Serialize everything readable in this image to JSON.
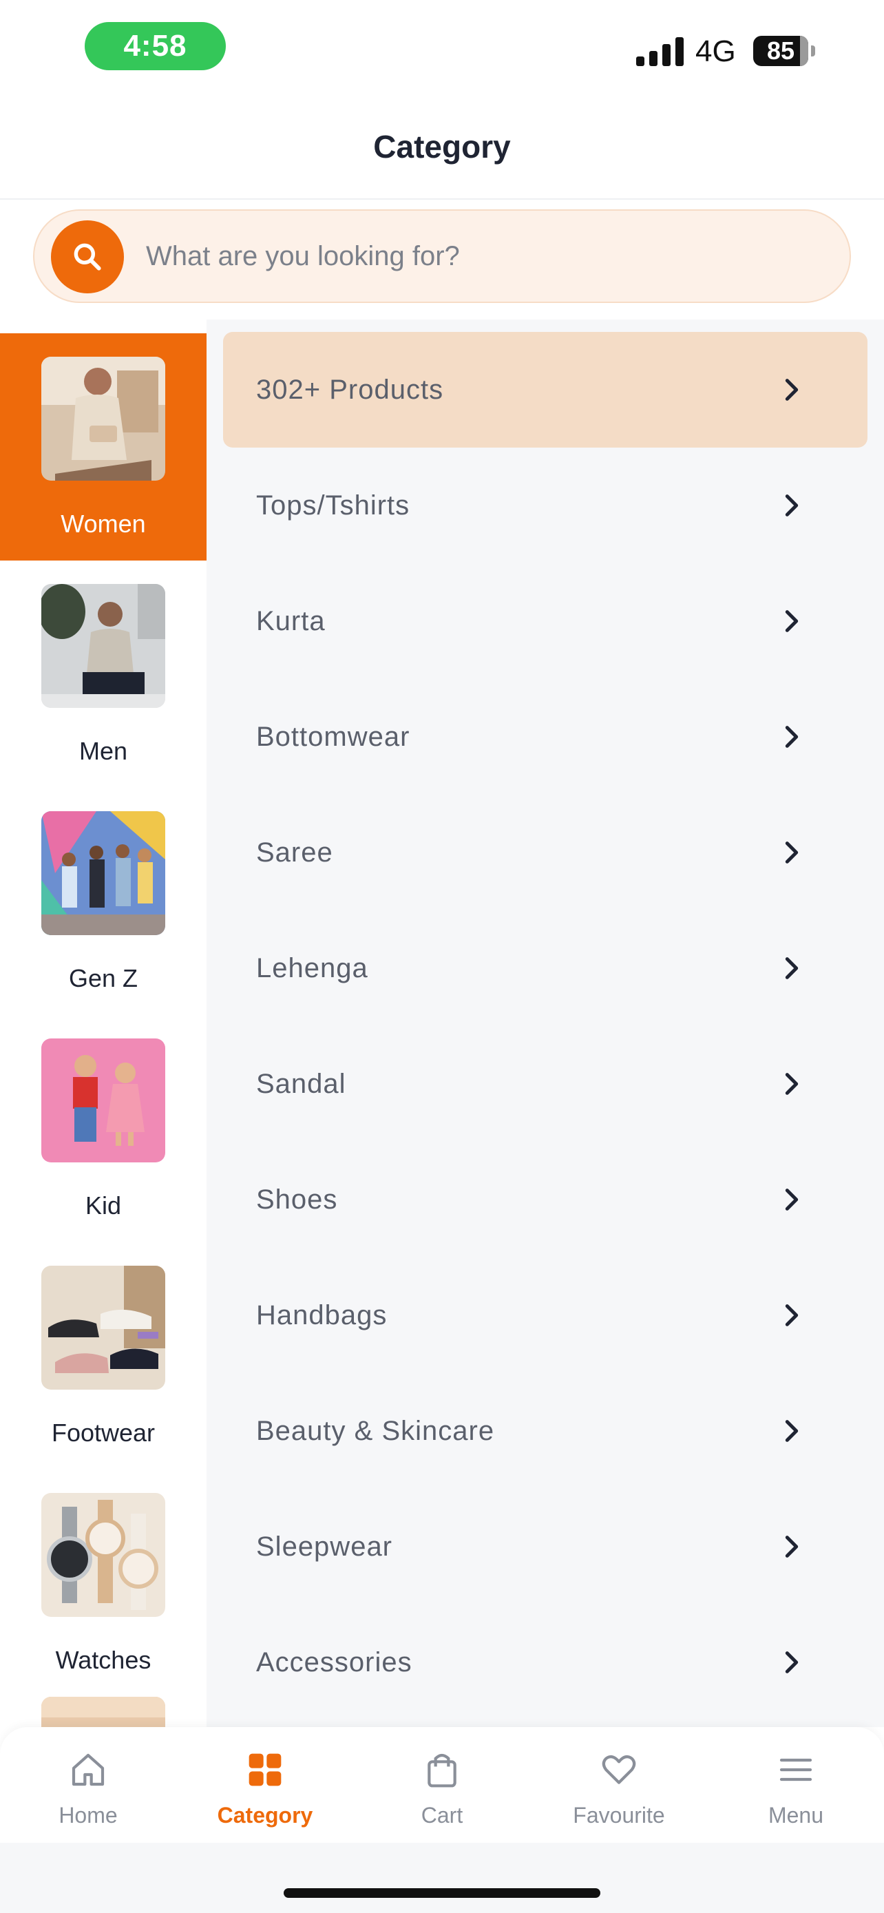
{
  "status_bar": {
    "time": "4:58",
    "network": "4G",
    "battery": "85",
    "battery_level": 0.85
  },
  "header": {
    "title": "Category"
  },
  "search": {
    "placeholder": "What are you looking for?",
    "icon": "search-icon"
  },
  "sidebar": {
    "items": [
      {
        "label": "Women",
        "active": true
      },
      {
        "label": "Men",
        "active": false
      },
      {
        "label": "Gen Z",
        "active": false
      },
      {
        "label": "Kid",
        "active": false
      },
      {
        "label": "Footwear",
        "active": false
      },
      {
        "label": "Watches",
        "active": false
      }
    ]
  },
  "categories": {
    "items": [
      "302+ Products",
      "Tops/Tshirts",
      "Kurta",
      "Bottomwear",
      "Saree",
      "Lehenga",
      "Sandal",
      "Shoes",
      "Handbags",
      "Beauty & Skincare",
      "Sleepwear",
      "Accessories"
    ]
  },
  "bottom_nav": {
    "items": [
      {
        "label": "Home",
        "icon": "home-icon",
        "active": false
      },
      {
        "label": "Category",
        "icon": "grid-icon",
        "active": true
      },
      {
        "label": "Cart",
        "icon": "bag-icon",
        "active": false
      },
      {
        "label": "Favourite",
        "icon": "heart-icon",
        "active": false
      },
      {
        "label": "Menu",
        "icon": "menu-icon",
        "active": false
      }
    ]
  },
  "colors": {
    "accent": "#ee6a0b",
    "highlight": "#f4dcc6",
    "list_bg": "#f6f7f9",
    "text": "#1f2433"
  }
}
